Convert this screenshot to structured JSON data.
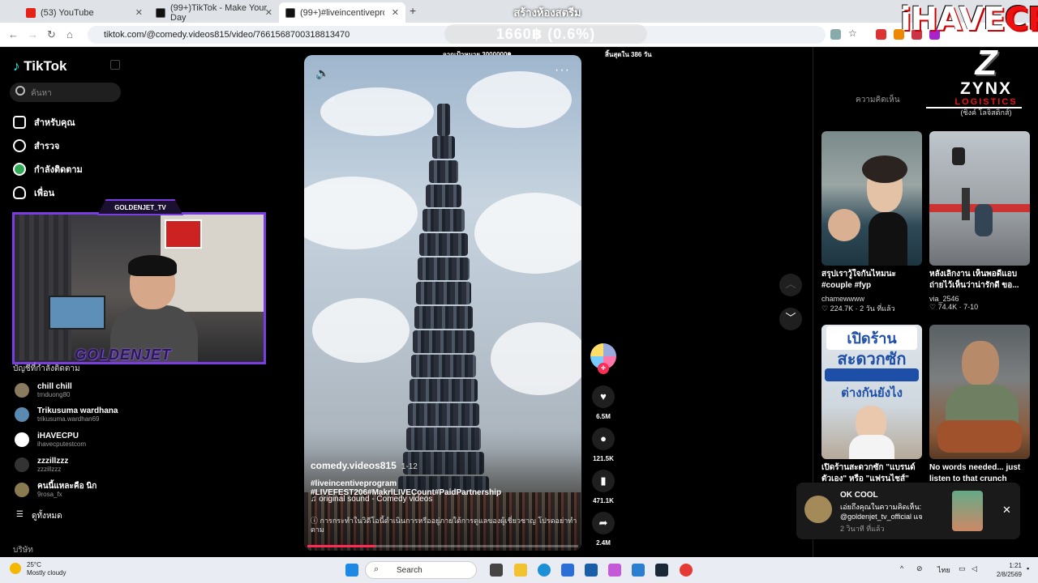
{
  "browser": {
    "tabs": [
      {
        "title": "(53) YouTube",
        "color": "#e62117"
      },
      {
        "title": "(99+)TikTok - Make Your Day",
        "color": "#111111"
      },
      {
        "title": "(99+)#liveincentiveprogram",
        "color": "#111111"
      }
    ],
    "url": "tiktok.com/@comedy.videos815/video/7661568700318813470"
  },
  "stream_overlay": {
    "title": "สร้างห้องสตรีม",
    "amount": "1660฿ (0.6%)",
    "goal": "จากเป้าหมาย 3000000฿",
    "remaining": "สิ้นสุดใน 386 วัน",
    "brand_main": "iHAVE",
    "brand_accent": "CPU",
    "webcam_tag": "GOLDENJET_TV",
    "webcam_name": "GOLDENJET",
    "sponsor": {
      "mark": "Z",
      "name": "ZYNX",
      "sub": "LOGISTICS",
      "thai": "(ซิงค์ โลจิสติกส์)"
    }
  },
  "sidebar": {
    "logo": "TikTok",
    "search_placeholder": "ค้นหา",
    "nav": [
      {
        "label": "สำหรับคุณ",
        "icon": "home-icon"
      },
      {
        "label": "สำรวจ",
        "icon": "compass-icon"
      },
      {
        "label": "กำลังติดตาม",
        "icon": "following-icon"
      },
      {
        "label": "เพื่อน",
        "icon": "friends-icon"
      }
    ],
    "following_header": "บัญชีที่กำลังติดตาม",
    "accounts": [
      {
        "name": "chill chill",
        "handle": "trnduong80",
        "color": "#8a7a60"
      },
      {
        "name": "Trikusuma wardhana",
        "handle": "trikusuma.wardhan69",
        "color": "#5a8ab0"
      },
      {
        "name": "iHAVECPU",
        "handle": "ihavecputestcom",
        "color": "#ffffff"
      },
      {
        "name": "zzzillzzz",
        "handle": "zzzillzzz",
        "color": "#333333"
      },
      {
        "name": "คนนี้แหละคือ นิก",
        "handle": "9rosa_fx",
        "color": "#8a7a50"
      }
    ],
    "view_all": "ดูทั้งหมด",
    "company": "บริษัท"
  },
  "video": {
    "username": "comedy.videos815",
    "date": "1-12",
    "tags": "#liveincentiveprogram #LIVEFEST206#MakrlLIVECount#PaidPartnership",
    "sound": "original sound - Comedy videos",
    "info": "การกระทำในวิดีโอนี้ดำเนินการหรืออยู่ภายใต้การดูแลของผู้เชี่ยวชาญ โปรดอย่าทำตาม",
    "progress": 0.25
  },
  "actions": {
    "likes": "6.5M",
    "comments": "121.5K",
    "saves": "471.1K",
    "shares": "2.4M"
  },
  "right_panel": {
    "tab_comments": "ความคิดเห็น",
    "cards": [
      {
        "title": "สรุปเราวู้ใจกันไหมนะ #couple #fyp",
        "user": "chamewwww",
        "meta": "224.7K · 2 วัน ที่แล้ว"
      },
      {
        "title": "หลังเลิกงาน เห็นพอดีแอบถ่ายไว้เห็นว่าน่ารักดี ขอ...",
        "user": "via_2546",
        "meta": "74.4K · 7-10"
      },
      {
        "title": "เปิดร้านสะดวกซัก \"แบรนด์ตัวเอง\" หรือ \"แฟรนไชส์\"",
        "user": "",
        "meta": "",
        "thumb_top": "เปิดร้าน",
        "thumb_mid": "สะดวกซัก",
        "thumb_bot": "ต่างกันยังไง"
      },
      {
        "title": "No words needed... just listen to that crunch",
        "user": "",
        "meta": ""
      }
    ]
  },
  "toast": {
    "title": "OK COOL",
    "body": "เอ่ยถึงคุณในความคิดเห็น: @goldenjet_tv_official แจ",
    "time": "2 วินาที ที่แล้ว"
  },
  "taskbar": {
    "temp": "25°C",
    "weather": "Mostly cloudy",
    "search": "Search",
    "lang": "ไทย",
    "time": "1:21",
    "date": "2/8/2569"
  }
}
